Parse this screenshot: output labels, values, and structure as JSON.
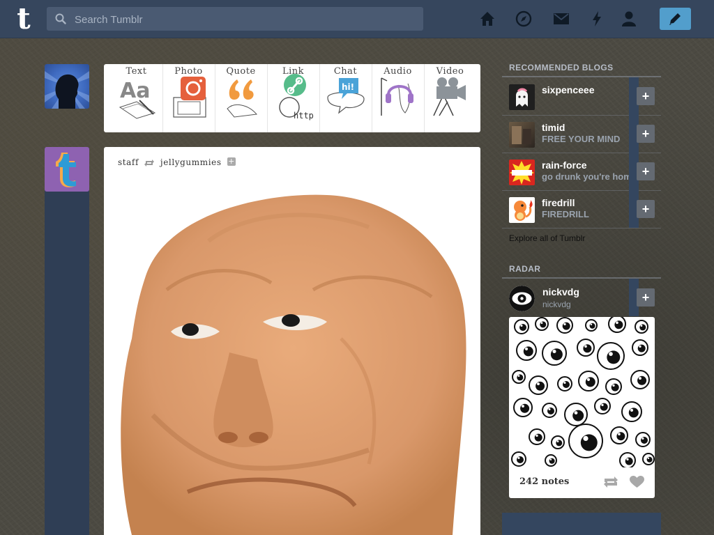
{
  "header": {
    "search_placeholder": "Search Tumblr",
    "nav_icons": [
      "home-icon",
      "explore-icon",
      "inbox-icon",
      "activity-icon",
      "account-icon"
    ],
    "compose_icon": "pencil-icon",
    "accent": "#529ecc",
    "background": "#36465d"
  },
  "post_types": [
    {
      "label": "Text",
      "icon": "text-icon"
    },
    {
      "label": "Photo",
      "icon": "photo-icon"
    },
    {
      "label": "Quote",
      "icon": "quote-icon"
    },
    {
      "label": "Link",
      "icon": "link-icon"
    },
    {
      "label": "Chat",
      "icon": "chat-icon"
    },
    {
      "label": "Audio",
      "icon": "audio-icon"
    },
    {
      "label": "Video",
      "icon": "video-icon"
    }
  ],
  "post": {
    "author": "staff",
    "reblogged_from": "jellygummies"
  },
  "sidebar": {
    "recommended_title": "RECOMMENDED BLOGS",
    "recommended": [
      {
        "name": "sixpenceee",
        "sub": ""
      },
      {
        "name": "timid",
        "sub": "FREE YOUR MIND"
      },
      {
        "name": "rain-force",
        "sub": "go drunk you're hom"
      },
      {
        "name": "firedrill",
        "sub": "FIREDRILL"
      }
    ],
    "explore_link": "Explore all of Tumblr",
    "radar_title": "RADAR",
    "radar": {
      "name": "nickvdg",
      "sub": "nickvdg",
      "notes": "242 notes"
    }
  }
}
